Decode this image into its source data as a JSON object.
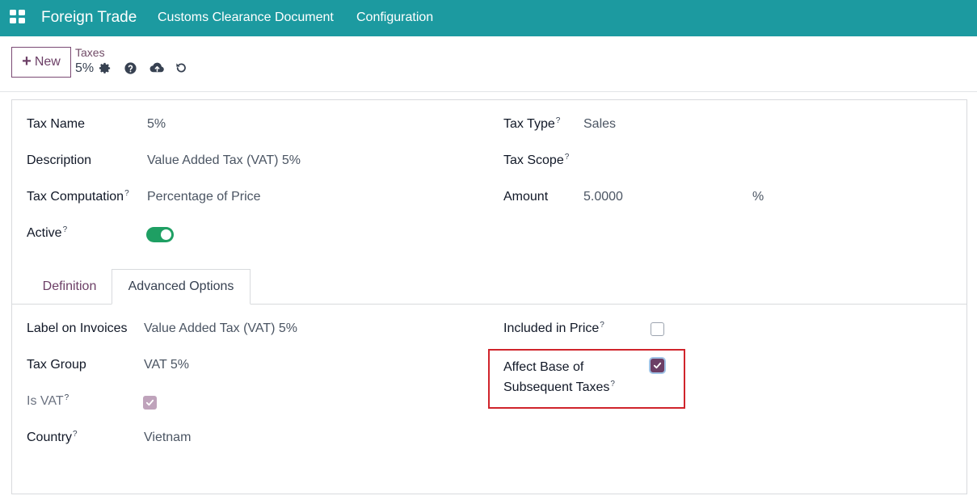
{
  "navbar": {
    "app_name": "Foreign Trade",
    "menu": [
      "Customs Clearance Document",
      "Configuration"
    ]
  },
  "control_panel": {
    "new_label": "New",
    "breadcrumb": "Taxes",
    "record_name": "5%"
  },
  "form": {
    "tax_name": {
      "label": "Tax Name",
      "value": "5%"
    },
    "description": {
      "label": "Description",
      "value": "Value Added Tax (VAT) 5%"
    },
    "tax_computation": {
      "label": "Tax Computation",
      "value": "Percentage of Price"
    },
    "active": {
      "label": "Active",
      "value": true
    },
    "tax_type": {
      "label": "Tax Type",
      "value": "Sales"
    },
    "tax_scope": {
      "label": "Tax Scope",
      "value": ""
    },
    "amount": {
      "label": "Amount",
      "value": "5.0000",
      "unit": "%"
    }
  },
  "tabs": [
    "Definition",
    "Advanced Options"
  ],
  "active_tab": "Advanced Options",
  "advanced": {
    "label_on_invoices": {
      "label": "Label on Invoices",
      "value": "Value Added Tax (VAT) 5%"
    },
    "tax_group": {
      "label": "Tax Group",
      "value": "VAT 5%"
    },
    "is_vat": {
      "label": "Is VAT",
      "value": true
    },
    "country": {
      "label": "Country",
      "value": "Vietnam"
    },
    "included_in_price": {
      "label": "Included in Price",
      "value": false
    },
    "affect_base_line1": "Affect Base of",
    "affect_base_line2": "Subsequent Taxes",
    "affect_base_value": true
  },
  "help_mark": "?",
  "colors": {
    "navbar": "#1c9aa0",
    "primary": "#714b67",
    "toggle_on": "#1e9f63",
    "highlight": "#d0242b"
  }
}
